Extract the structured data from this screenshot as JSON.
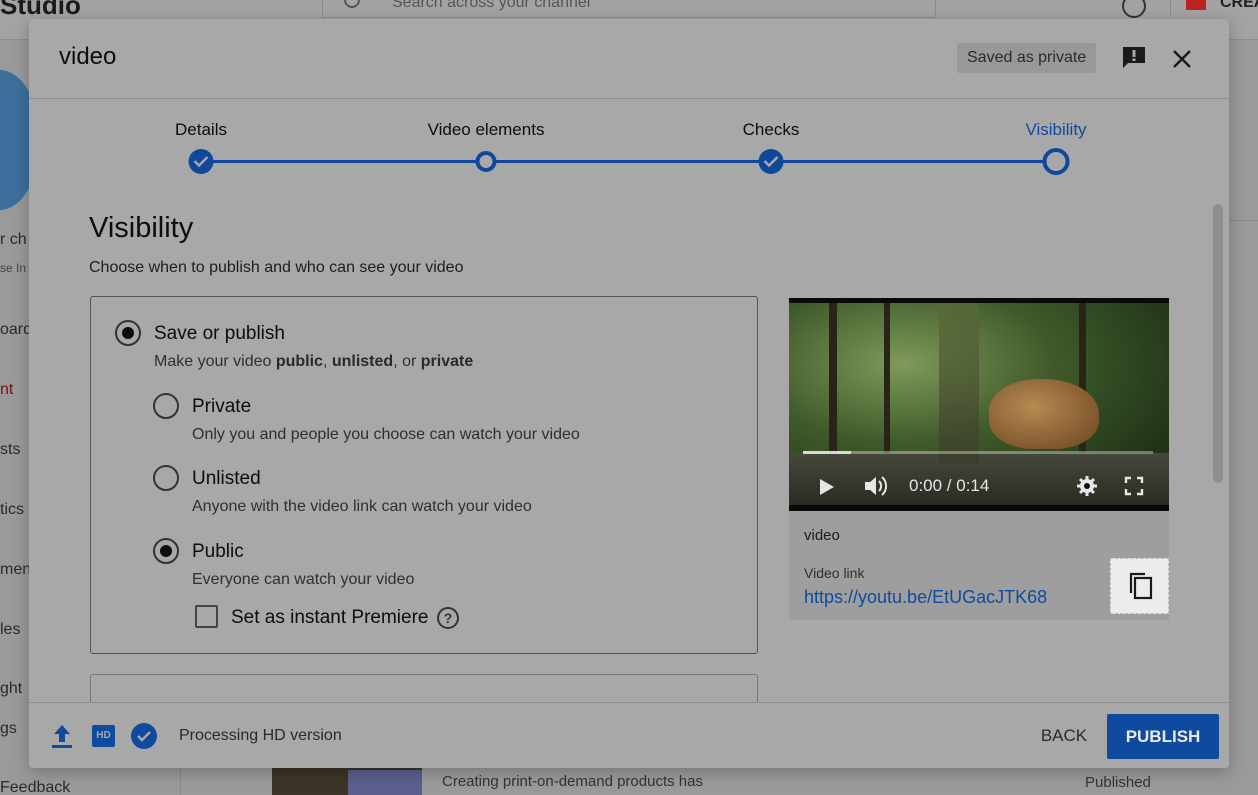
{
  "background": {
    "logo_text": "Studio",
    "search_placeholder": "Search across your channel",
    "create_label": "CREATE",
    "sidebar_fragments": [
      "r ch",
      "se In",
      "oard",
      "nt",
      "sts",
      "tics",
      "ment",
      "les",
      "ght",
      "gs",
      "Feedback"
    ],
    "row_title": "Creating print-on-demand products has",
    "row_status": "Published"
  },
  "dialog": {
    "title": "video",
    "saved_badge": "Saved as private",
    "feedback_icon": "report-feedback-icon",
    "close_icon": "close-icon"
  },
  "stepper": {
    "steps": [
      {
        "label": "Details",
        "state": "done"
      },
      {
        "label": "Video elements",
        "state": "open"
      },
      {
        "label": "Checks",
        "state": "done"
      },
      {
        "label": "Visibility",
        "state": "current"
      }
    ],
    "accent": "#0f489b"
  },
  "visibility": {
    "title": "Visibility",
    "subtitle": "Choose when to publish and who can see your video",
    "save_or_publish": {
      "label": "Save or publish",
      "desc_prefix": "Make your video ",
      "desc_public": "public",
      "desc_sep1": ", ",
      "desc_unlisted": "unlisted",
      "desc_sep2": ", or ",
      "desc_private": "private",
      "selected": true
    },
    "options": [
      {
        "label": "Private",
        "desc": "Only you and people you choose can watch your video",
        "selected": false
      },
      {
        "label": "Unlisted",
        "desc": "Anyone with the video link can watch your video",
        "selected": false
      },
      {
        "label": "Public",
        "desc": "Everyone can watch your video",
        "selected": true
      }
    ],
    "premiere": {
      "label": "Set as instant Premiere",
      "checked": false,
      "help_icon": "help-circle-icon"
    }
  },
  "preview": {
    "time": "0:00 / 0:14",
    "video_name": "video",
    "link_label": "Video link",
    "link": "https://youtu.be/EtUGacJTK68",
    "copy_icon": "copy-icon"
  },
  "footer": {
    "status": "Processing HD version",
    "hd_label": "HD",
    "back": "BACK",
    "publish": "PUBLISH",
    "publish_color": "#0f4a9e"
  }
}
